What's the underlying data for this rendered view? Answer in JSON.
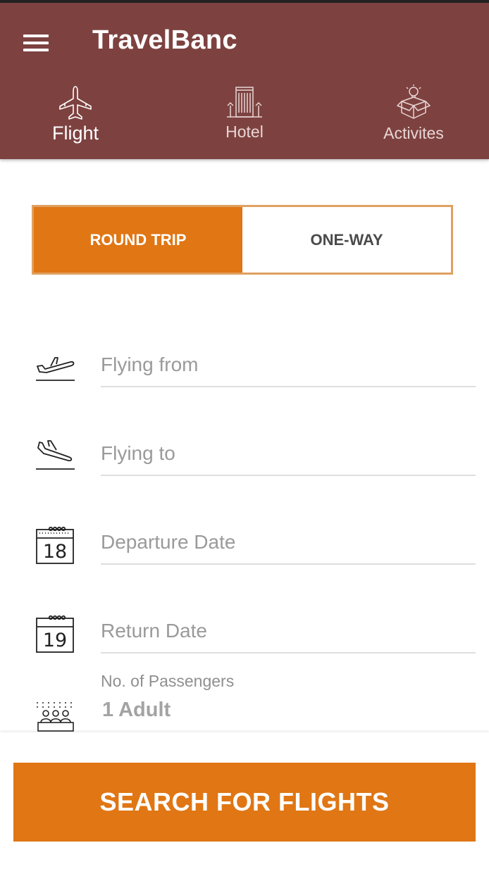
{
  "app": {
    "title": "TravelBanc"
  },
  "tabs": [
    {
      "label": "Flight",
      "icon": "airplane-icon",
      "active": true
    },
    {
      "label": "Hotel",
      "icon": "hotel-building-icon",
      "active": false
    },
    {
      "label": "Activites",
      "icon": "activity-box-icon",
      "active": false
    }
  ],
  "trip_type": {
    "options": [
      "ROUND TRIP",
      "ONE-WAY"
    ],
    "selected": "ROUND TRIP"
  },
  "form": {
    "flying_from": {
      "placeholder": "Flying from",
      "icon": "takeoff-icon"
    },
    "flying_to": {
      "placeholder": "Flying to",
      "icon": "landing-icon"
    },
    "departure_date": {
      "placeholder": "Departure Date",
      "icon": "calendar-icon",
      "icon_day": "18"
    },
    "return_date": {
      "placeholder": "Return Date",
      "icon": "calendar-icon",
      "icon_day": "19"
    },
    "passengers": {
      "label": "No. of Passengers",
      "value": "1 Adult",
      "icon": "passengers-icon"
    }
  },
  "actions": {
    "search_label": "SEARCH FOR FLIGHTS"
  },
  "colors": {
    "appbar": "#7d4240",
    "accent": "#e07614",
    "toggle_border": "#e0a060"
  }
}
